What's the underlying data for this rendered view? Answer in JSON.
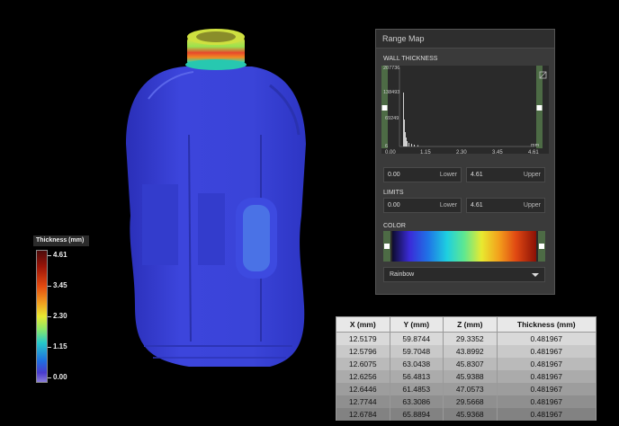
{
  "legend": {
    "title": "Thickness (mm)",
    "ticks": [
      "4.61",
      "3.45",
      "2.30",
      "1.15",
      "0.00"
    ]
  },
  "panel": {
    "title": "Range Map",
    "wall_thickness_label": "WALL THICKNESS",
    "hist_y_ticks": [
      "207736",
      "138493",
      "69249",
      "6"
    ],
    "hist_x_ticks": [
      "0.00",
      "1.15",
      "2.30",
      "3.45",
      "4.61"
    ],
    "hist_unit": "mm",
    "range_lower_value": "0.00",
    "range_lower_label": "Lower",
    "range_upper_value": "4.61",
    "range_upper_label": "Upper",
    "limits_label": "LIMITS",
    "limits_lower_value": "0.00",
    "limits_lower_label": "Lower",
    "limits_upper_value": "4.61",
    "limits_upper_label": "Upper",
    "color_label": "COLOR",
    "colormap": "Rainbow"
  },
  "table": {
    "headers": [
      "X (mm)",
      "Y (mm)",
      "Z (mm)",
      "Thickness (mm)"
    ],
    "rows": [
      [
        "12.5179",
        "59.8744",
        "29.3352",
        "0.481967"
      ],
      [
        "12.5796",
        "59.7048",
        "43.8992",
        "0.481967"
      ],
      [
        "12.6075",
        "63.0438",
        "45.8307",
        "0.481967"
      ],
      [
        "12.6256",
        "56.4813",
        "45.9388",
        "0.481967"
      ],
      [
        "12.6446",
        "61.4853",
        "47.0573",
        "0.481967"
      ],
      [
        "12.7744",
        "63.3086",
        "29.5668",
        "0.481967"
      ],
      [
        "12.6784",
        "65.8894",
        "45.9368",
        "0.481967"
      ]
    ]
  },
  "colors": {
    "bottle_body": "#3a42d8",
    "panel_bg": "#3a3a3a",
    "slider_green": "#4d6b45"
  }
}
